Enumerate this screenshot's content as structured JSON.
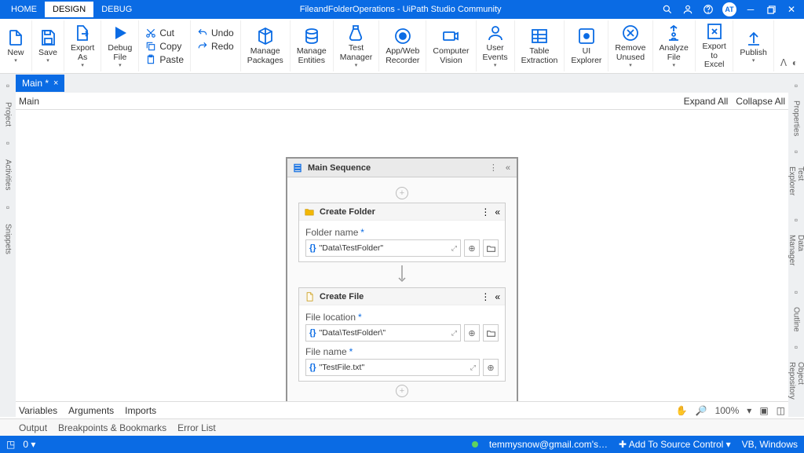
{
  "title": "FileandFolderOperations - UiPath Studio Community",
  "menu": {
    "home": "HOME",
    "design": "DESIGN",
    "debug": "DEBUG"
  },
  "avatar": "AT",
  "ribbon": {
    "new": "New",
    "save": "Save",
    "exportAs": "Export\nAs",
    "debugFile": "Debug\nFile",
    "cut": "Cut",
    "undo": "Undo",
    "copy": "Copy",
    "redo": "Redo",
    "paste": "Paste",
    "managePackages": "Manage\nPackages",
    "manageEntities": "Manage\nEntities",
    "testManager": "Test\nManager",
    "appWeb": "App/Web\nRecorder",
    "computerVision": "Computer\nVision",
    "userEvents": "User\nEvents",
    "tableExtraction": "Table\nExtraction",
    "uiExplorer": "UI\nExplorer",
    "removeUnused": "Remove\nUnused",
    "analyzeFile": "Analyze\nFile",
    "exportExcel": "Export\nto Excel",
    "publish": "Publish"
  },
  "tabs": {
    "main": "Main *"
  },
  "breadcrumb": {
    "main": "Main",
    "expand": "Expand All",
    "collapse": "Collapse All"
  },
  "leftTabs": {
    "project": "Project",
    "activities": "Activities",
    "snippets": "Snippets"
  },
  "rightTabs": {
    "properties": "Properties",
    "testExplorer": "Test Explorer",
    "dataManager": "Data Manager",
    "outline": "Outline",
    "objectRepo": "Object Repository"
  },
  "sequence": {
    "title": "Main Sequence",
    "createFolder": {
      "title": "Create Folder",
      "folderNameLabel": "Folder name",
      "folderNameValue": "\"Data\\TestFolder\""
    },
    "createFile": {
      "title": "Create File",
      "fileLocationLabel": "File location",
      "fileLocationValue": "\"Data\\TestFolder\\\"",
      "fileNameLabel": "File name",
      "fileNameValue": "\"TestFile.txt\""
    }
  },
  "bottom": {
    "variables": "Variables",
    "arguments": "Arguments",
    "imports": "Imports",
    "zoom": "100%"
  },
  "output": {
    "output": "Output",
    "breakpoints": "Breakpoints & Bookmarks",
    "errorList": "Error List"
  },
  "status": {
    "count": "0",
    "email": "temmysnow@gmail.com's…",
    "sourceControl": "Add To Source Control",
    "lang": "VB, Windows"
  }
}
